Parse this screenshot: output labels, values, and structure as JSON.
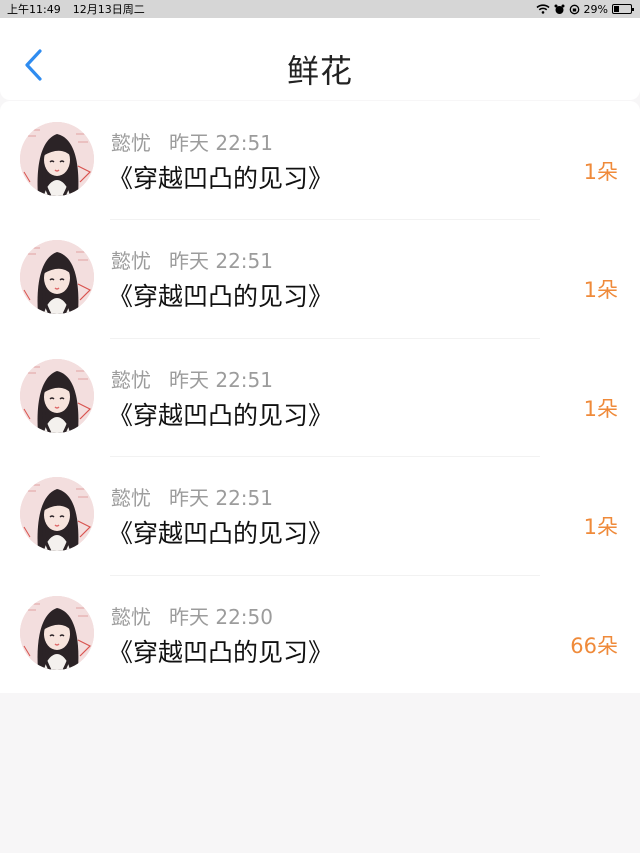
{
  "status_bar": {
    "time": "上午11:49",
    "date": "12月13日周二",
    "battery": "29%",
    "battery_level": 0.29
  },
  "nav": {
    "title": "鲜花"
  },
  "colors": {
    "accent": "#2f8cf0",
    "count": "#ef8a3a",
    "meta": "#9c9c9c"
  },
  "items": [
    {
      "user": "懿忧",
      "time": "昨天 22:51",
      "title": "《穿越凹凸的见习》",
      "count": "1朵"
    },
    {
      "user": "懿忧",
      "time": "昨天 22:51",
      "title": "《穿越凹凸的见习》",
      "count": "1朵"
    },
    {
      "user": "懿忧",
      "time": "昨天 22:51",
      "title": "《穿越凹凸的见习》",
      "count": "1朵"
    },
    {
      "user": "懿忧",
      "time": "昨天 22:51",
      "title": "《穿越凹凸的见习》",
      "count": "1朵"
    },
    {
      "user": "懿忧",
      "time": "昨天 22:50",
      "title": "《穿越凹凸的见习》",
      "count": "66朵"
    }
  ]
}
